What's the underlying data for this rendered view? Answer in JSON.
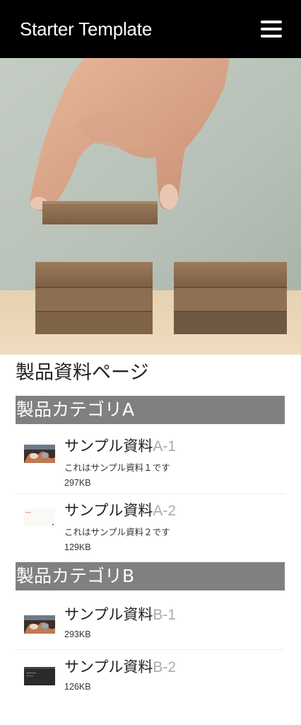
{
  "navbar": {
    "brand": "Starter Template",
    "menu_icon": "hamburger-icon"
  },
  "hero": {
    "image": "hand-stacking-wooden-blocks"
  },
  "page": {
    "title": "製品資料ページ"
  },
  "categories": [
    {
      "heading": "製品カテゴリA",
      "items": [
        {
          "title": "サンプル資料",
          "code": "A-1",
          "description": "これはサンプル資料１です",
          "size": "297KB",
          "thumbnail": "photo-thumbnail"
        },
        {
          "title": "サンプル資料",
          "code": "A-2",
          "description": "これはサンプル資料２です",
          "size": "129KB",
          "thumbnail": "document-thumbnail"
        }
      ]
    },
    {
      "heading": "製品カテゴリB",
      "items": [
        {
          "title": "サンプル資料",
          "code": "B-1",
          "size": "293KB",
          "thumbnail": "photo-thumbnail"
        },
        {
          "title": "サンプル資料",
          "code": "B-2",
          "size": "126KB",
          "thumbnail": "dark-screen-thumbnail"
        }
      ]
    }
  ],
  "colors": {
    "navbar_bg": "#000000",
    "category_bg": "#808080",
    "code_text": "#aaaaaa"
  }
}
